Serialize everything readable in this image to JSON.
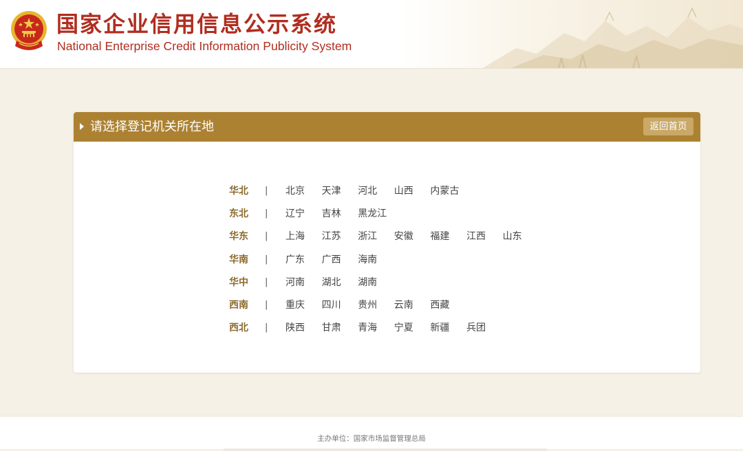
{
  "header": {
    "title_cn": "国家企业信用信息公示系统",
    "title_en": "National Enterprise Credit Information Publicity System"
  },
  "panel": {
    "title": "请选择登记机关所在地",
    "back_label": "返回首页",
    "separator": "|"
  },
  "regions": [
    {
      "name": "华北",
      "provinces": [
        "北京",
        "天津",
        "河北",
        "山西",
        "内蒙古"
      ]
    },
    {
      "name": "东北",
      "provinces": [
        "辽宁",
        "吉林",
        "黑龙江"
      ]
    },
    {
      "name": "华东",
      "provinces": [
        "上海",
        "江苏",
        "浙江",
        "安徽",
        "福建",
        "江西",
        "山东"
      ]
    },
    {
      "name": "华南",
      "provinces": [
        "广东",
        "广西",
        "海南"
      ]
    },
    {
      "name": "华中",
      "provinces": [
        "河南",
        "湖北",
        "湖南"
      ]
    },
    {
      "name": "西南",
      "provinces": [
        "重庆",
        "四川",
        "贵州",
        "云南",
        "西藏"
      ]
    },
    {
      "name": "西北",
      "provinces": [
        "陕西",
        "甘肃",
        "青海",
        "宁夏",
        "新疆",
        "兵团"
      ]
    }
  ],
  "footer": {
    "organizer": "主办单位：国家市场监督管理总局"
  },
  "colors": {
    "brand_red": "#b02d1f",
    "panel_gold": "#ac8232",
    "region_brown": "#8c6a2d",
    "page_bg": "#f5f1e6"
  }
}
